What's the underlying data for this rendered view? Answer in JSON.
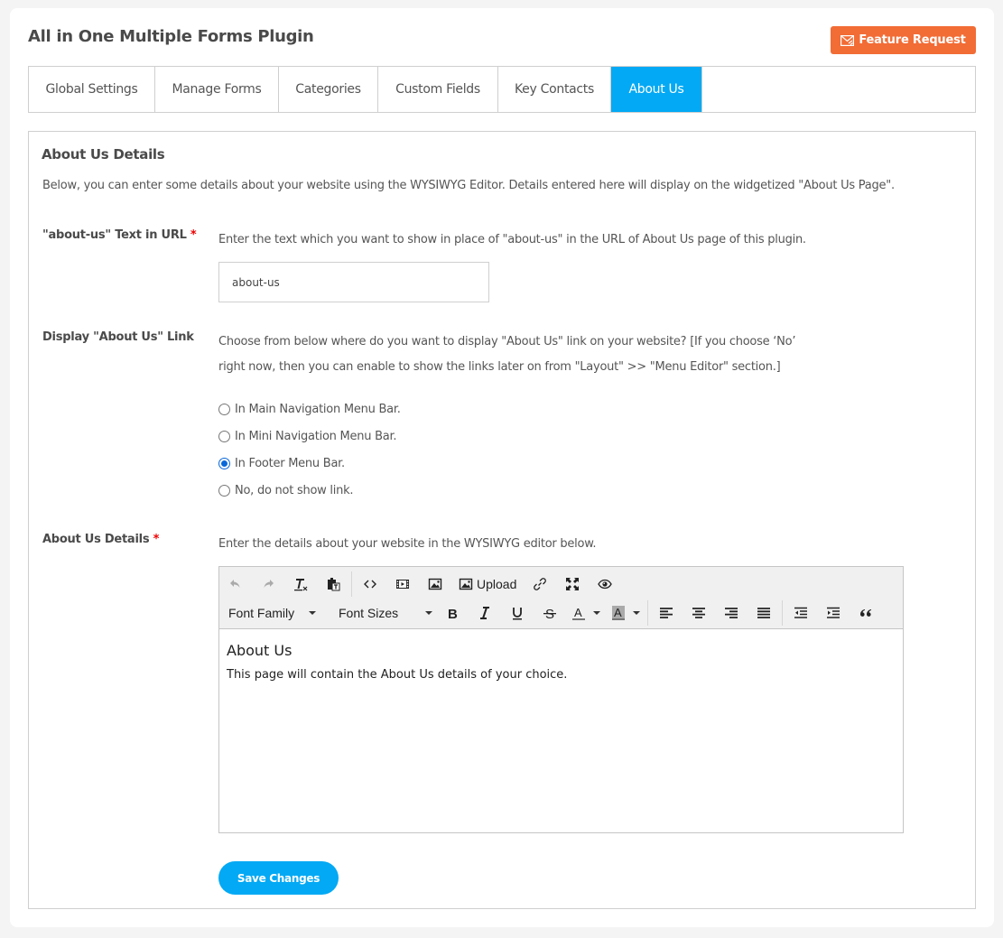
{
  "header": {
    "title": "All in One Multiple Forms Plugin",
    "feature_request_label": "Feature Request",
    "feature_request_icon": "envelope-icon"
  },
  "tabs": [
    {
      "label": "Global Settings",
      "active": false
    },
    {
      "label": "Manage Forms",
      "active": false
    },
    {
      "label": "Categories",
      "active": false
    },
    {
      "label": "Custom Fields",
      "active": false
    },
    {
      "label": "Key Contacts",
      "active": false
    },
    {
      "label": "About Us",
      "active": true
    }
  ],
  "section": {
    "title": "About Us Details",
    "intro": "Below, you can enter some details about your website using the WYSIWYG Editor. Details entered here will display on the widgetized \"About Us Page\"."
  },
  "url_field": {
    "label": "\"about-us\" Text in URL",
    "required_mark": "*",
    "help": "Enter the text which you want to show in place of \"about-us\" in the URL of About Us page of this plugin.",
    "value": "about-us"
  },
  "display_link": {
    "label": "Display \"About Us\" Link",
    "help_line1": "Choose from below where do you want to display \"About Us\" link on your website? [If you choose ‘No’",
    "help_line2": "right now, then you can enable to show the links later on from \"Layout\" >> \"Menu Editor\" section.]",
    "options": [
      {
        "label": "In Main Navigation Menu Bar.",
        "checked": false
      },
      {
        "label": "In Mini Navigation Menu Bar.",
        "checked": false
      },
      {
        "label": "In Footer Menu Bar.",
        "checked": true
      },
      {
        "label": "No, do not show link.",
        "checked": false
      }
    ]
  },
  "details_field": {
    "label": "About Us Details",
    "required_mark": "*",
    "help": "Enter the details about your website in the WYSIWYG editor below."
  },
  "editor": {
    "toolbar_row1": [
      "undo-icon",
      "redo-icon",
      "clear-formatting-icon",
      "paste-as-text-icon",
      "source-code-icon",
      "insert-video-icon",
      "insert-image-icon",
      "upload-image-icon",
      "link-icon",
      "fullscreen-icon",
      "preview-icon"
    ],
    "upload_label": "Upload",
    "font_family_label": "Font Family",
    "font_sizes_label": "Font Sizes",
    "toolbar_row2": [
      "bold-icon",
      "italic-icon",
      "underline-icon",
      "strikethrough-icon",
      "text-color-icon",
      "background-color-icon",
      "align-left-icon",
      "align-center-icon",
      "align-right-icon",
      "align-justify-icon",
      "outdent-icon",
      "indent-icon",
      "blockquote-icon"
    ],
    "content_heading": "About Us",
    "content_paragraph": "This page will contain the About Us details of your choice."
  },
  "save_label": "Save Changes",
  "colors": {
    "accent": "#03a9f4",
    "feature_button": "#f26c35",
    "required": "#ee0000"
  }
}
